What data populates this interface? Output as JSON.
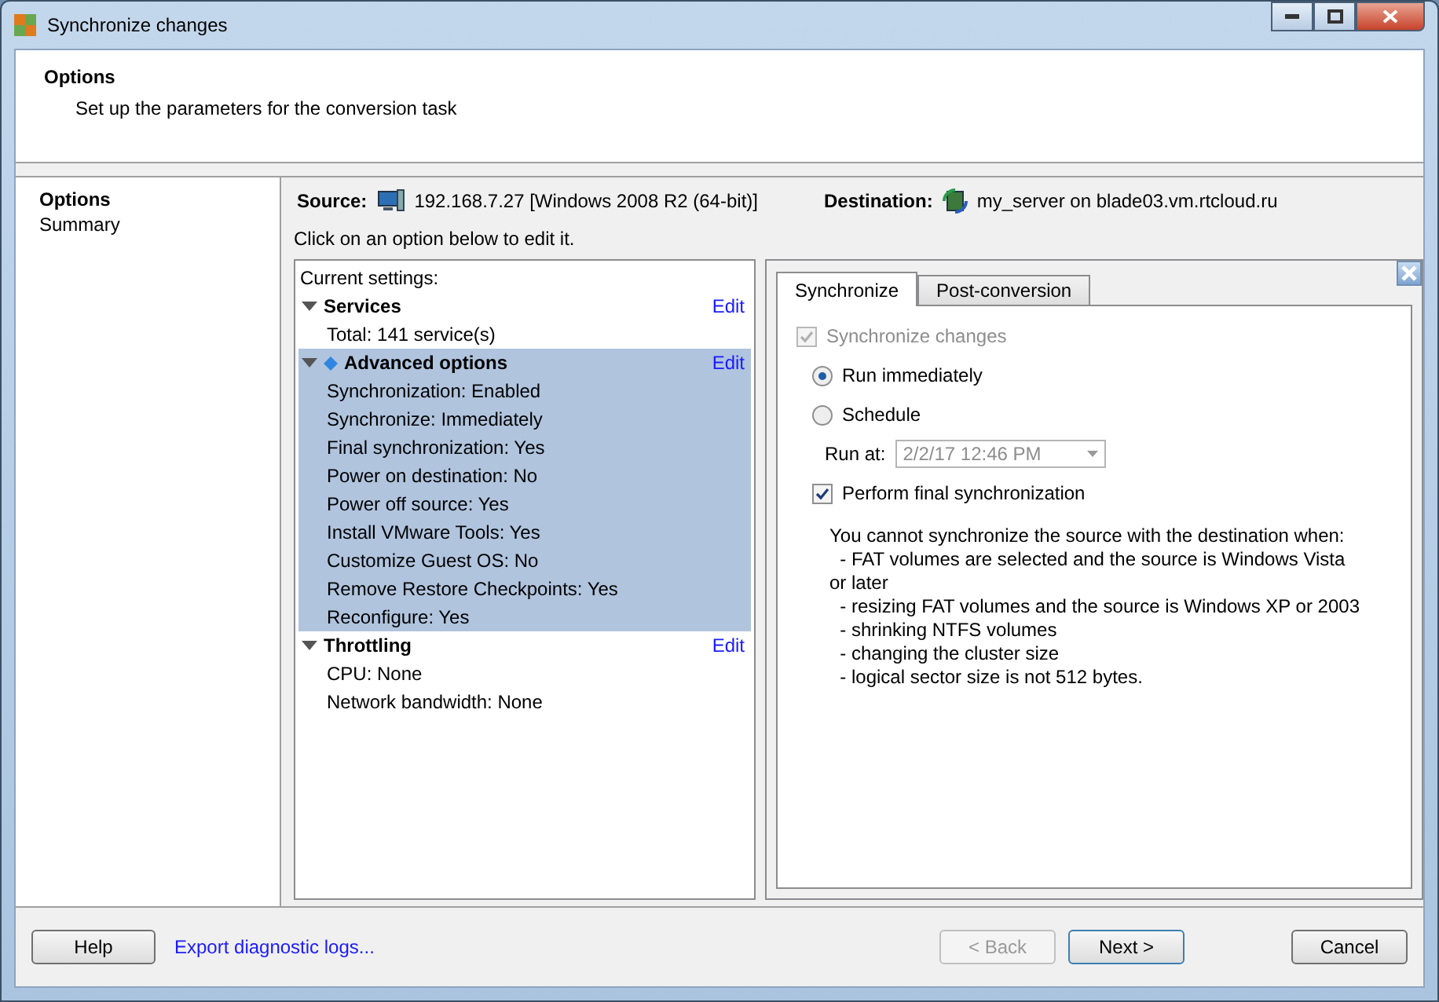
{
  "window": {
    "title": "Synchronize changes"
  },
  "header": {
    "title": "Options",
    "subtitle": "Set up the parameters for the conversion task"
  },
  "nav": [
    {
      "label": "Options",
      "selected": true
    },
    {
      "label": "Summary",
      "selected": false
    }
  ],
  "source": {
    "label": "Source:",
    "value": "192.168.7.27 [Windows 2008 R2 (64-bit)]"
  },
  "destination": {
    "label": "Destination:",
    "value": "my_server on blade03.vm.rtcloud.ru"
  },
  "hint": "Click on an option below to edit it.",
  "settings": {
    "heading": "Current settings:",
    "groups": [
      {
        "title": "Services",
        "edit": "Edit",
        "expanded": true,
        "selected": false,
        "kind": "plain",
        "items": [
          "Total: 141 service(s)"
        ]
      },
      {
        "title": "Advanced options",
        "edit": "Edit",
        "expanded": true,
        "selected": true,
        "kind": "marked",
        "items": [
          "Synchronization: Enabled",
          "Synchronize: Immediately",
          "Final synchronization: Yes",
          "Power on destination: No",
          "Power off source: Yes",
          "Install VMware Tools: Yes",
          "Customize Guest OS: No",
          "Remove Restore Checkpoints: Yes",
          "Reconfigure: Yes"
        ]
      },
      {
        "title": "Throttling",
        "edit": "Edit",
        "expanded": true,
        "selected": false,
        "kind": "plain",
        "items": [
          "CPU: None",
          "Network bandwidth: None"
        ]
      }
    ]
  },
  "tabs": [
    {
      "label": "Synchronize",
      "selected": true
    },
    {
      "label": "Post-conversion",
      "selected": false
    }
  ],
  "sync_checkbox": {
    "label": "Synchronize changes",
    "checked": true,
    "disabled": true
  },
  "radios": [
    {
      "label": "Run immediately",
      "selected": true
    },
    {
      "label": "Schedule",
      "selected": false
    }
  ],
  "run_at": {
    "label": "Run at:",
    "value": "2/2/17 12:46 PM",
    "disabled": true
  },
  "final_checkbox": {
    "label": "Perform final synchronization",
    "checked": true,
    "disabled": false
  },
  "note": [
    "You cannot synchronize the source with the destination when:",
    "  - FAT volumes are selected and the source is Windows Vista or later",
    "  - resizing FAT volumes and the source is Windows XP or 2003",
    "  - shrinking NTFS volumes",
    "  - changing the cluster size",
    "  - logical sector size is not 512 bytes."
  ],
  "footer": {
    "help": "Help",
    "link": "Export diagnostic logs...",
    "back": {
      "label": "< Back",
      "disabled": true
    },
    "next": {
      "label": "Next >",
      "disabled": false
    },
    "cancel": "Cancel"
  }
}
